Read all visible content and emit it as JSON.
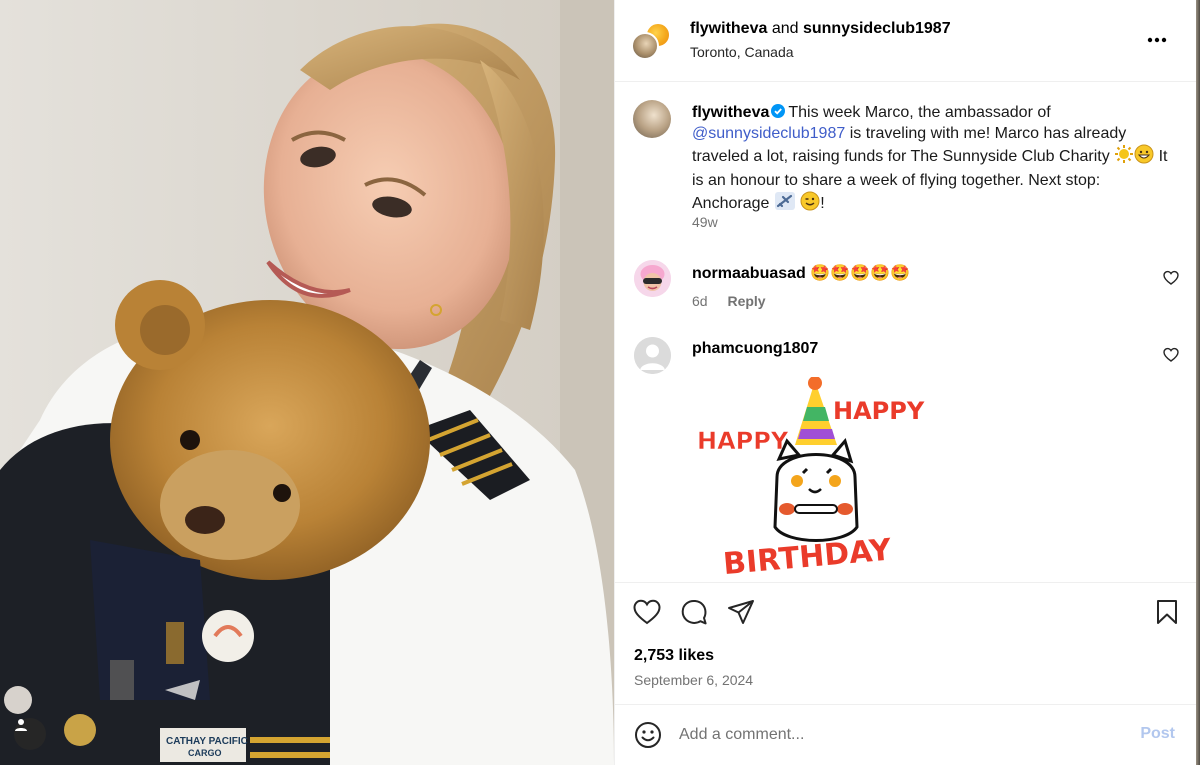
{
  "photo": {
    "alt_subject": "selfie with teddy bear",
    "patch_text_1": "CATHAY PACIFIC",
    "patch_text_2": "CARGO",
    "tag_icon": "user-tag-icon"
  },
  "header": {
    "user1": "flywitheva",
    "connector": "and",
    "user2": "sunnysideclub1987",
    "location": "Toronto, Canada",
    "more_icon": "more-horizontal-icon"
  },
  "caption": {
    "username": "flywitheva",
    "text_1": "This week Marco, the ambassador of",
    "mention": "@sunnysideclub1987",
    "text_2": "is traveling with me! Marco has already traveled a lot, raising funds for The Sunnyside Club Charity",
    "text_3": "It is an honour to share a week of flying together. Next stop: Anchorage",
    "text_end": "!",
    "time": "49w"
  },
  "comments": [
    {
      "username": "normaabuasad",
      "emojis": "🤩🤩🤩🤩🤩",
      "time": "6d",
      "reply": "Reply"
    },
    {
      "username": "phamcuong1807",
      "gif_text_1": "HAPPY",
      "gif_text_2": "HAPPY",
      "gif_text_3": "BIRTHDAY"
    }
  ],
  "actions": {
    "like_icon": "heart-icon",
    "comment_icon": "comment-icon",
    "share_icon": "send-icon",
    "save_icon": "bookmark-icon",
    "likes": "2,753 likes",
    "date": "September 6, 2024"
  },
  "comment_box": {
    "placeholder": "Add a comment...",
    "post": "Post"
  },
  "colors": {
    "mention": "#3f5dc9",
    "muted": "#737373",
    "post_disabled": "#b2c7ee",
    "verified": "#0095f6"
  }
}
